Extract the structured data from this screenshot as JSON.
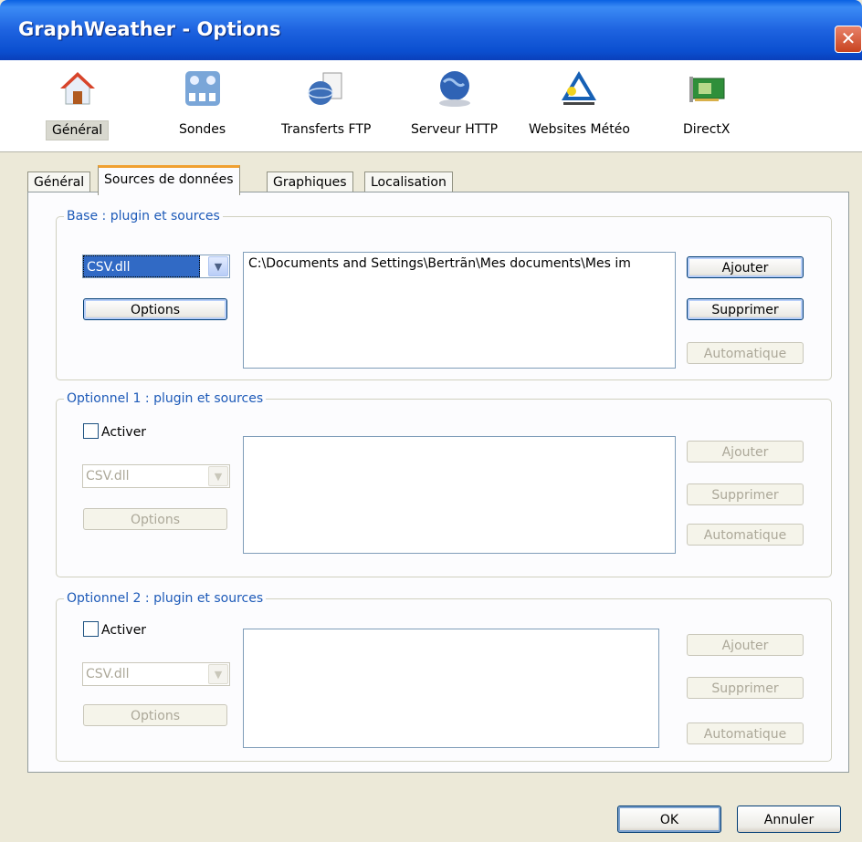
{
  "window": {
    "title": "GraphWeather - Options",
    "close_symbol": "✕"
  },
  "toolbar": {
    "items": [
      {
        "label": "Général",
        "icon": "home-icon",
        "selected": true
      },
      {
        "label": "Sondes",
        "icon": "sensor-network-icon"
      },
      {
        "label": "Transferts FTP",
        "icon": "ftp-transfer-icon"
      },
      {
        "label": "Serveur HTTP",
        "icon": "globe-server-icon"
      },
      {
        "label": "Websites Météo",
        "icon": "awekas-logo-icon"
      },
      {
        "label": "DirectX",
        "icon": "graphics-card-icon"
      }
    ]
  },
  "tabs": [
    {
      "label": "Général"
    },
    {
      "label": "Sources de données",
      "active": true
    },
    {
      "label": "Graphiques"
    },
    {
      "label": "Localisation"
    }
  ],
  "groups": {
    "base": {
      "legend": "Base : plugin et sources",
      "plugin": "CSV.dll",
      "options_label": "Options",
      "sources": [
        "C:\\Documents and Settings\\Bertrãn\\Mes documents\\Mes im"
      ],
      "add_label": "Ajouter",
      "remove_label": "Supprimer",
      "auto_label": "Automatique"
    },
    "opt1": {
      "legend": "Optionnel 1 : plugin et sources",
      "activate_label": "Activer",
      "plugin": "CSV.dll",
      "options_label": "Options",
      "add_label": "Ajouter",
      "remove_label": "Supprimer",
      "auto_label": "Automatique"
    },
    "opt2": {
      "legend": "Optionnel 2 : plugin et sources",
      "activate_label": "Activer",
      "plugin": "CSV.dll",
      "options_label": "Options",
      "add_label": "Ajouter",
      "remove_label": "Supprimer",
      "auto_label": "Automatique"
    }
  },
  "footer": {
    "ok_label": "OK",
    "cancel_label": "Annuler"
  },
  "colors": {
    "title_bar": "#0a4fd0",
    "group_legend": "#1d5ab8",
    "active_tab_accent": "#f0a030"
  }
}
